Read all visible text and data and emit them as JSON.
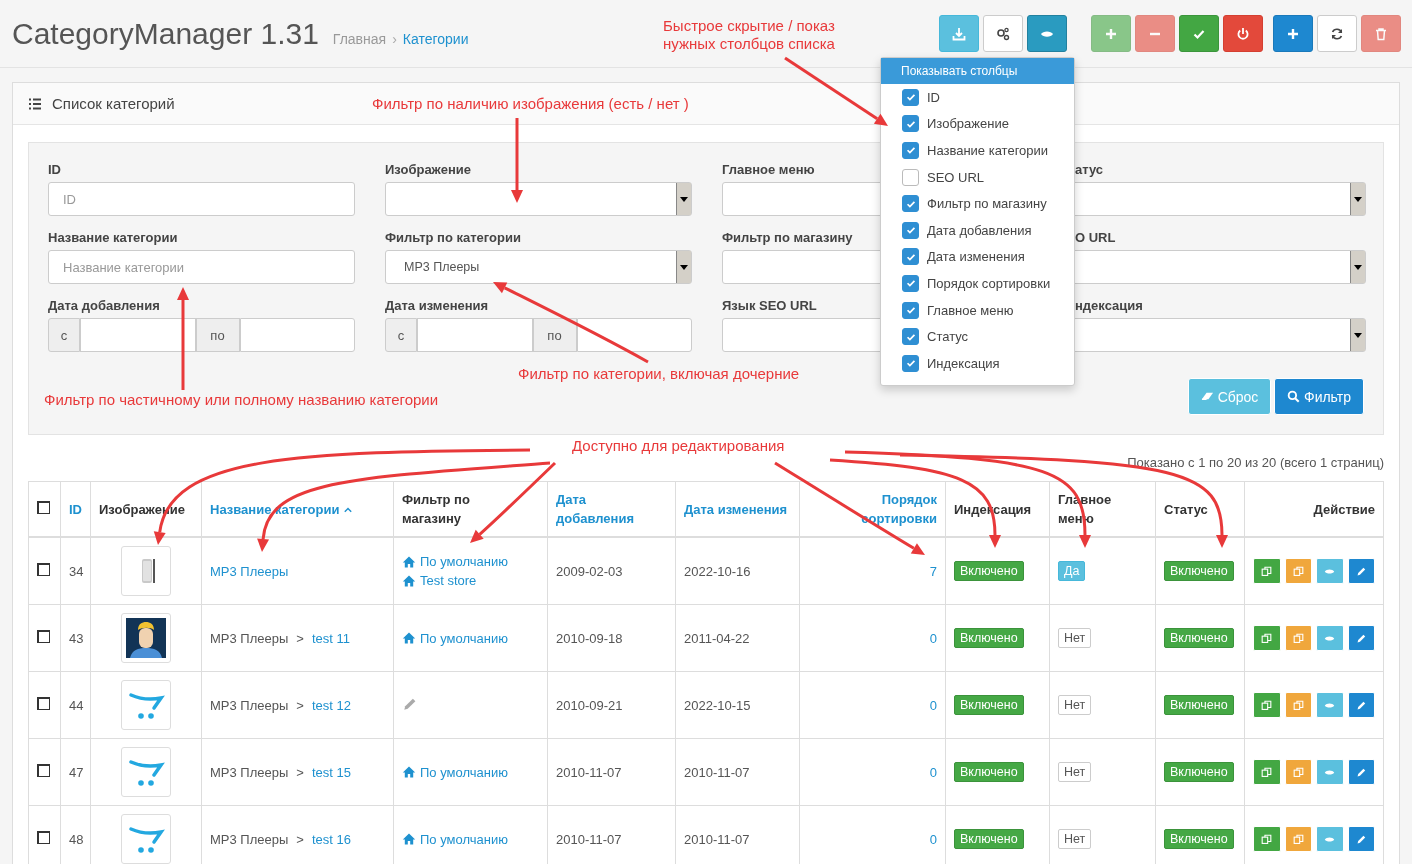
{
  "header": {
    "title": "CategoryManager 1.31",
    "breadcrumb": [
      {
        "text": "Главная",
        "link": false
      },
      {
        "text": "Категории",
        "link": true
      }
    ],
    "breadcrumb_separator": "›"
  },
  "toolbar": [
    {
      "buttons": [
        {
          "kind": "info",
          "disabled": false,
          "active": false
        },
        {
          "kind": "default",
          "disabled": false,
          "active": false
        },
        {
          "kind": "info",
          "disabled": false,
          "active": true
        }
      ]
    },
    {
      "buttons": [
        {
          "kind": "success",
          "disabled": true,
          "active": false
        },
        {
          "kind": "danger",
          "disabled": true,
          "active": false
        },
        {
          "kind": "success",
          "disabled": false,
          "active": false
        },
        {
          "kind": "danger",
          "disabled": false,
          "active": false
        }
      ]
    },
    {
      "buttons": [
        {
          "kind": "primary",
          "disabled": false,
          "active": false
        },
        {
          "kind": "default",
          "disabled": false,
          "active": false
        },
        {
          "kind": "danger",
          "disabled": true,
          "active": false
        }
      ]
    }
  ],
  "column_menu": {
    "title": "Показывать столбцы",
    "items": [
      {
        "label": "ID",
        "checked": true
      },
      {
        "label": "Изображение",
        "checked": true
      },
      {
        "label": "Название категории",
        "checked": true
      },
      {
        "label": "SEO URL",
        "checked": false
      },
      {
        "label": "Фильтр по магазину",
        "checked": true
      },
      {
        "label": "Дата добавления",
        "checked": true
      },
      {
        "label": "Дата изменения",
        "checked": true
      },
      {
        "label": "Порядок сортировки",
        "checked": true
      },
      {
        "label": "Главное меню",
        "checked": true
      },
      {
        "label": "Статус",
        "checked": true
      },
      {
        "label": "Индексация",
        "checked": true
      }
    ]
  },
  "panel": {
    "title": "Список категорий"
  },
  "filters": [
    {
      "label": "ID",
      "kind": "text",
      "placeholder": "ID"
    },
    {
      "label": "Изображение",
      "kind": "select"
    },
    {
      "label": "Главное меню",
      "kind": "select"
    },
    {
      "label": "атус",
      "kind": "select"
    },
    {
      "label": "Название категории",
      "kind": "text",
      "placeholder": "Название категории"
    },
    {
      "label": "Фильтр по категории",
      "kind": "select",
      "value": "MP3 Плееры"
    },
    {
      "label": "Фильтр по магазину",
      "kind": "select"
    },
    {
      "label": "O URL",
      "kind": "select"
    },
    {
      "label": "Дата добавления",
      "kind": "daterange",
      "from": "с",
      "to": "по"
    },
    {
      "label": "Дата изменения",
      "kind": "daterange",
      "from": "с",
      "to": "по"
    },
    {
      "label": "Язык SEO URL",
      "kind": "select"
    },
    {
      "label": "ндексация",
      "kind": "select"
    }
  ],
  "filter_buttons": [
    {
      "label": "Сброс",
      "kind": "info"
    },
    {
      "label": "Фильтр",
      "kind": "primary"
    }
  ],
  "annotations": [
    {
      "text": "Быстрое скрытие / показ\nнужных столбцов списка"
    },
    {
      "text": "Фильтр по наличию изображения (есть / нет )"
    },
    {
      "text": "Фильтр по категории, включая дочерние"
    },
    {
      "text": "Фильтр по частичному или полному названию категории"
    },
    {
      "text": "Доступно для редактирования"
    }
  ],
  "table": {
    "info": "Показано с 1 по 20 из 20 (всего 1 страниц)",
    "select_all_checked": false,
    "columns": [
      {
        "label": "ID",
        "sortable": true,
        "sorted": false
      },
      {
        "label": "Изображение",
        "sortable": false,
        "sorted": false
      },
      {
        "label": "Название категории",
        "sortable": true,
        "sorted": true
      },
      {
        "label": "Фильтр по магазину",
        "sortable": false,
        "sorted": false
      },
      {
        "label": "Дата добавления",
        "sortable": true,
        "sorted": false
      },
      {
        "label": "Дата изменения",
        "sortable": true,
        "sorted": false
      },
      {
        "label": "Порядок сортировки",
        "sortable": true,
        "sorted": false
      },
      {
        "label": "Индексация",
        "sortable": false,
        "sorted": false
      },
      {
        "label": "Главное меню",
        "sortable": false,
        "sorted": false
      },
      {
        "label": "Статус",
        "sortable": false,
        "sorted": false
      },
      {
        "label": "Действие",
        "sortable": false,
        "sorted": false
      }
    ],
    "rows": [
      {
        "checked": false,
        "id": "34",
        "image": {
          "kind": "picture"
        },
        "name": {
          "name": "MP3 Плееры"
        },
        "stores": [
          "По умолчанию",
          "Test store"
        ],
        "date_added": "2009-02-03",
        "date_modified": "2022-10-16",
        "sort_order": "7",
        "indexing": {
          "text": "Включено",
          "on": true
        },
        "main_menu": {
          "text": "Да",
          "on": true
        },
        "status": {
          "text": "Включено",
          "on": true
        }
      },
      {
        "checked": false,
        "id": "43",
        "image": {
          "kind": "picture"
        },
        "name": {
          "parent": "MP3 Плееры",
          "separator": ">",
          "name": "test 11"
        },
        "stores": [
          "По умолчанию"
        ],
        "date_added": "2010-09-18",
        "date_modified": "2011-04-22",
        "sort_order": "0",
        "indexing": {
          "text": "Включено",
          "on": true
        },
        "main_menu": {
          "text": "Нет",
          "on": false
        },
        "status": {
          "text": "Включено",
          "on": true
        }
      },
      {
        "checked": false,
        "id": "44",
        "image": {
          "kind": "picture"
        },
        "name": {
          "parent": "MP3 Плееры",
          "separator": ">",
          "name": "test 12"
        },
        "date_added": "2010-09-21",
        "date_modified": "2022-10-15",
        "sort_order": "0",
        "indexing": {
          "text": "Включено",
          "on": true
        },
        "main_menu": {
          "text": "Нет",
          "on": false
        },
        "status": {
          "text": "Включено",
          "on": true
        }
      },
      {
        "checked": false,
        "id": "47",
        "image": {
          "kind": "picture"
        },
        "name": {
          "parent": "MP3 Плееры",
          "separator": ">",
          "name": "test 15"
        },
        "stores": [
          "По умолчанию"
        ],
        "date_added": "2010-11-07",
        "date_modified": "2010-11-07",
        "sort_order": "0",
        "indexing": {
          "text": "Включено",
          "on": true
        },
        "main_menu": {
          "text": "Нет",
          "on": false
        },
        "status": {
          "text": "Включено",
          "on": true
        }
      },
      {
        "checked": false,
        "id": "48",
        "image": {
          "kind": "picture"
        },
        "name": {
          "parent": "MP3 Плееры",
          "separator": ">",
          "name": "test 16"
        },
        "stores": [
          "По умолчанию"
        ],
        "date_added": "2010-11-07",
        "date_modified": "2010-11-07",
        "sort_order": "0",
        "indexing": {
          "text": "Включено",
          "on": true
        },
        "main_menu": {
          "text": "Нет",
          "on": false
        },
        "status": {
          "text": "Включено",
          "on": true
        }
      }
    ]
  }
}
